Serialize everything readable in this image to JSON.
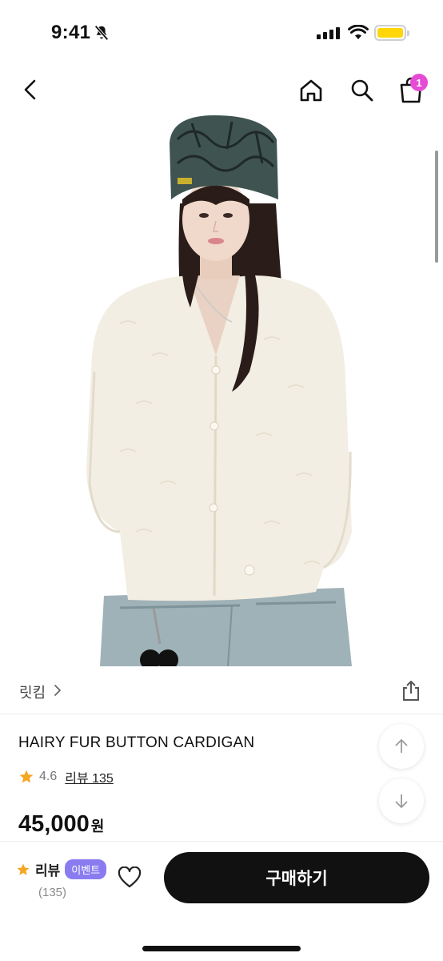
{
  "status_bar": {
    "time": "9:41"
  },
  "header": {
    "cart_count": "1"
  },
  "product": {
    "brand": "릿킴",
    "title": "HAIRY FUR BUTTON CARDIGAN",
    "rating": "4.6",
    "review_link": "리뷰 135",
    "price": "45,000",
    "currency": "원"
  },
  "bottom_bar": {
    "review_label": "리뷰",
    "event_badge": "이벤트",
    "review_count": "(135)",
    "buy_label": "구매하기"
  },
  "colors": {
    "accent_badge": "#e54bd4",
    "event_badge": "#8a7cf0",
    "star": "#f5a623",
    "buy_button": "#111111"
  },
  "icons": [
    "bell-off-icon",
    "signal-icon",
    "wifi-icon",
    "battery-icon",
    "back-arrow-icon",
    "home-icon",
    "search-icon",
    "shopping-bag-icon",
    "chevron-right-icon",
    "share-icon",
    "arrow-up-icon",
    "arrow-down-icon",
    "star-icon",
    "heart-icon"
  ]
}
